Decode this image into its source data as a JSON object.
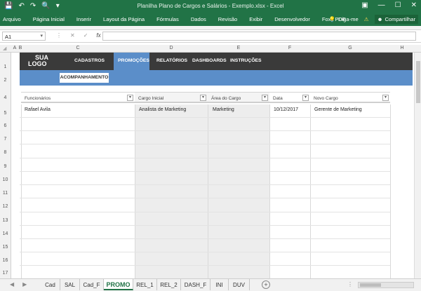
{
  "window": {
    "title": "Planilha Plano de Cargos e Salários - Exemplo.xlsx  -  Excel",
    "save_icon": "save-icon",
    "undo_icon": "undo-icon",
    "redo_icon": "redo-icon"
  },
  "ribbon": {
    "tabs": [
      "Arquivo",
      "Página Inicial",
      "Inserir",
      "Layout da Página",
      "Fórmulas",
      "Dados",
      "Revisão",
      "Exibir",
      "Desenvolvedor",
      "Foxit PDF"
    ],
    "tell_me": "Diga-me",
    "share": "Compartilhar"
  },
  "formula_bar": {
    "name_box": "A1",
    "fx": "fx",
    "value": ""
  },
  "columns": [
    "A",
    "B",
    "C",
    "D",
    "E",
    "F",
    "G",
    "H"
  ],
  "rows": [
    "1",
    "2",
    "4",
    "5",
    "6",
    "7",
    "8",
    "9",
    "10",
    "11",
    "12",
    "13",
    "14",
    "15",
    "16",
    "17"
  ],
  "sheet_nav": {
    "logo_line1": "SUA",
    "logo_line2": "LOGO",
    "items": [
      "CADASTROS",
      "PROMOÇÕES",
      "RELATÓRIOS",
      "DASHBOARDS",
      "INSTRUÇÕES"
    ],
    "active": "PROMOÇÕES",
    "subtab": "ACOMPANHAMENTO"
  },
  "table": {
    "headers": [
      "Funcionários",
      "Cargo Inicial",
      "Área do Cargo",
      "Data",
      "Novo Cargo"
    ],
    "rows": [
      [
        "Rafael Avila",
        "Analista de Marketing",
        "Marketing",
        "10/12/2017",
        "Gerente de Marketing"
      ]
    ]
  },
  "sheet_tabs": [
    "Cad",
    "SAL",
    "Cad_F",
    "PROMO",
    "REL_1",
    "REL_2",
    "DASH_F",
    "INI",
    "DUV"
  ],
  "active_sheet": "PROMO",
  "colors": {
    "excel_green": "#217346",
    "nav_dark": "#3a3a3a",
    "nav_blue": "#5b8ec9"
  }
}
